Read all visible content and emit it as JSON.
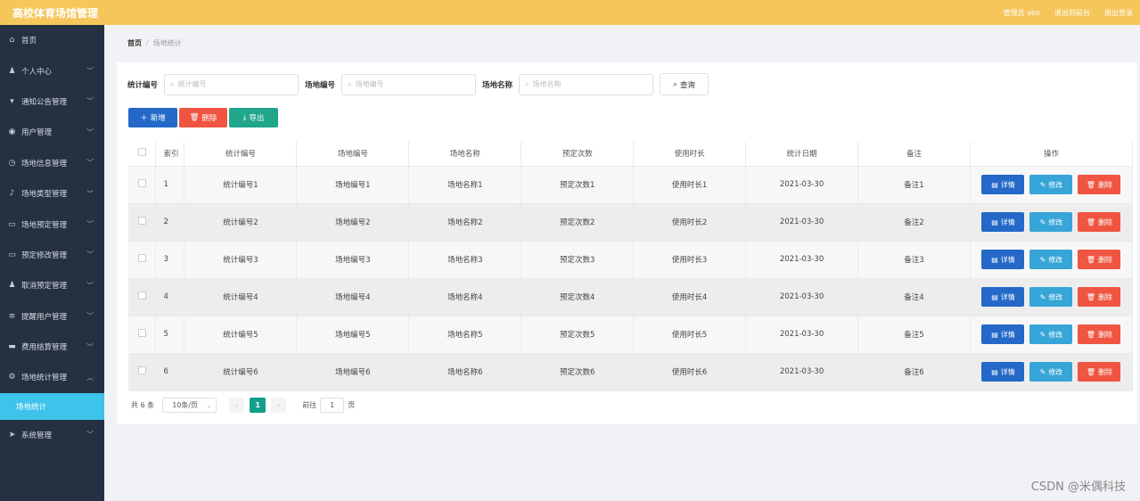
{
  "header": {
    "title": "高校体育场馆管理",
    "admin": "管理员 abo",
    "back_to_front": "退出到前台",
    "logout": "退出登录"
  },
  "sidebar": {
    "items": [
      {
        "label": "首页",
        "icon": "home-icon",
        "chevron": false
      },
      {
        "label": "个人中心",
        "icon": "user-icon",
        "chevron": true
      },
      {
        "label": "通知公告管理",
        "icon": "notice-icon",
        "chevron": true
      },
      {
        "label": "用户管理",
        "icon": "location-icon",
        "chevron": true
      },
      {
        "label": "场地信息管理",
        "icon": "clock-icon",
        "chevron": true
      },
      {
        "label": "场地类型管理",
        "icon": "mic-icon",
        "chevron": true
      },
      {
        "label": "场地预定管理",
        "icon": "card-icon",
        "chevron": true
      },
      {
        "label": "预定修改管理",
        "icon": "card-icon",
        "chevron": true
      },
      {
        "label": "取消预定管理",
        "icon": "user-icon",
        "chevron": true
      },
      {
        "label": "提醒用户管理",
        "icon": "list-icon",
        "chevron": true
      },
      {
        "label": "费用结算管理",
        "icon": "message-icon",
        "chevron": true
      },
      {
        "label": "场地统计管理",
        "icon": "gear-icon",
        "chevron": true,
        "open": true
      }
    ],
    "active_sub": "场地统计",
    "last_item": {
      "label": "系统管理",
      "icon": "send-icon"
    }
  },
  "breadcrumb": {
    "home": "首页",
    "current": "场地统计"
  },
  "search": {
    "fields": [
      {
        "label": "统计编号",
        "placeholder": "统计编号"
      },
      {
        "label": "场地编号",
        "placeholder": "场地编号"
      },
      {
        "label": "场地名称",
        "placeholder": "场地名称"
      }
    ],
    "query_label": "查询"
  },
  "actions": {
    "add": "新增",
    "delete": "删除",
    "export": "导出"
  },
  "table": {
    "headers": [
      "索引",
      "统计编号",
      "场地编号",
      "场地名称",
      "预定次数",
      "使用时长",
      "统计日期",
      "备注",
      "操作"
    ],
    "rows": [
      [
        "1",
        "统计编号1",
        "场地编号1",
        "场地名称1",
        "预定次数1",
        "使用时长1",
        "2021-03-30",
        "备注1"
      ],
      [
        "2",
        "统计编号2",
        "场地编号2",
        "场地名称2",
        "预定次数2",
        "使用时长2",
        "2021-03-30",
        "备注2"
      ],
      [
        "3",
        "统计编号3",
        "场地编号3",
        "场地名称3",
        "预定次数3",
        "使用时长3",
        "2021-03-30",
        "备注3"
      ],
      [
        "4",
        "统计编号4",
        "场地编号4",
        "场地名称4",
        "预定次数4",
        "使用时长4",
        "2021-03-30",
        "备注4"
      ],
      [
        "5",
        "统计编号5",
        "场地编号5",
        "场地名称5",
        "预定次数5",
        "使用时长5",
        "2021-03-30",
        "备注5"
      ],
      [
        "6",
        "统计编号6",
        "场地编号6",
        "场地名称6",
        "预定次数6",
        "使用时长6",
        "2021-03-30",
        "备注6"
      ]
    ],
    "op_detail": "详情",
    "op_edit": "修改",
    "op_delete": "删除"
  },
  "pagination": {
    "total": "共 6 条",
    "page_size": "10条/页",
    "current_page": "1",
    "goto_prefix": "前往",
    "goto_value": "1",
    "goto_suffix": "页"
  },
  "watermark": "CSDN @米偶科技",
  "colors": {
    "header": "#f5c65a",
    "sidebar": "#253142",
    "active_sub": "#3ec3ea",
    "primary": "#2468c8",
    "danger": "#ef5541",
    "success": "#20a68b",
    "info": "#37a5d7"
  }
}
